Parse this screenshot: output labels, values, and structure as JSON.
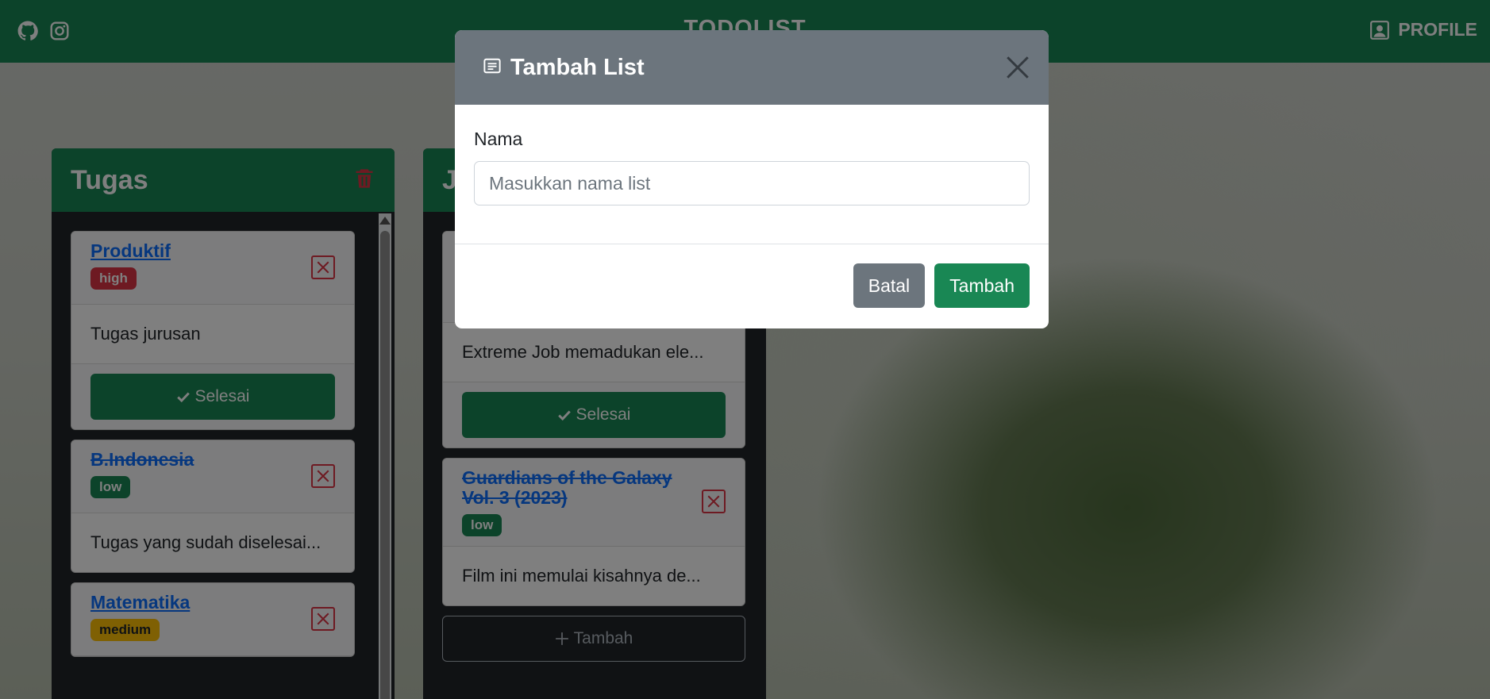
{
  "navbar": {
    "brand": "TODOLIST",
    "profile_label": "PROFILE",
    "icons": [
      "github-icon",
      "instagram-icon",
      "profile-icon"
    ],
    "color": "#198754"
  },
  "boards": [
    {
      "title": "Tugas",
      "cards": [
        {
          "name": "Produktif",
          "priority": "high",
          "description": "Tugas jurusan",
          "done": false,
          "action": "Selesai"
        },
        {
          "name": "B.Indonesia",
          "priority": "low",
          "description": "Tugas yang sudah diselesai...",
          "done": true
        },
        {
          "name": "Matematika",
          "priority": "medium",
          "done": false
        }
      ]
    },
    {
      "title": "J",
      "cards": [
        {
          "description": "Extreme Job memadukan ele...",
          "action": "Selesai"
        },
        {
          "name": "Guardians of the Galaxy Vol. 3 (2023)",
          "priority": "low",
          "description": "Film ini memulai kisahnya de...",
          "done": true
        }
      ],
      "add_label": "Tambah"
    }
  ],
  "modal": {
    "title": "Tambah List",
    "field_label": "Nama",
    "input_placeholder": "Masukkan nama list",
    "input_value": "",
    "cancel_label": "Batal",
    "submit_label": "Tambah"
  },
  "colors": {
    "success": "#198754",
    "danger": "#dc3545",
    "warning": "#ffc107",
    "secondary": "#6c757d",
    "link": "#0d6efd"
  }
}
